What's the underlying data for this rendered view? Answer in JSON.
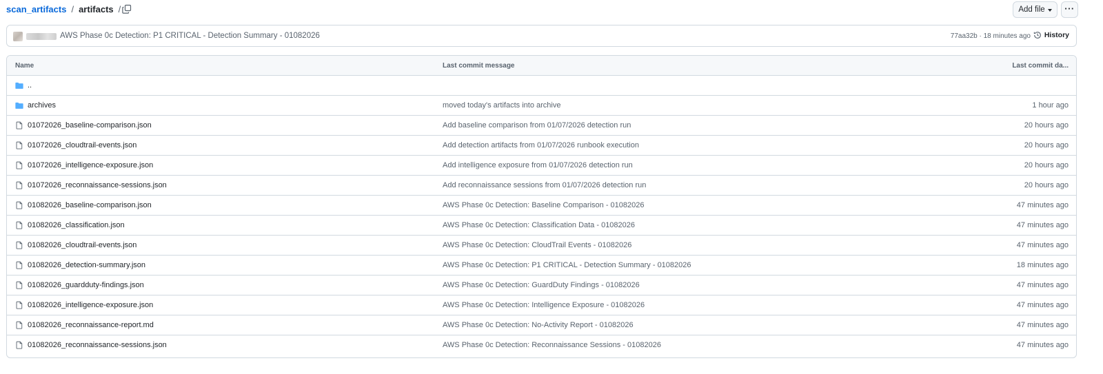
{
  "breadcrumb": {
    "root": "scan_artifacts",
    "separator": "/",
    "current": "artifacts",
    "trailing_separator": "/"
  },
  "toolbar": {
    "add_file_label": "Add file",
    "more_label": "···"
  },
  "commit": {
    "message": "AWS Phase 0c Detection: P1 CRITICAL - Detection Summary - 01082026",
    "meta": "77aa32b · 18 minutes ago",
    "history_label": "History"
  },
  "table": {
    "headers": {
      "name": "Name",
      "message": "Last commit message",
      "date": "Last commit da..."
    },
    "rows": [
      {
        "type": "folder",
        "name": "..",
        "message": "",
        "date": ""
      },
      {
        "type": "folder",
        "name": "archives",
        "message": "moved today's artifacts into archive",
        "date": "1 hour ago"
      },
      {
        "type": "file",
        "name": "01072026_baseline-comparison.json",
        "message": "Add baseline comparison from 01/07/2026 detection run",
        "date": "20 hours ago"
      },
      {
        "type": "file",
        "name": "01072026_cloudtrail-events.json",
        "message": "Add detection artifacts from 01/07/2026 runbook execution",
        "date": "20 hours ago"
      },
      {
        "type": "file",
        "name": "01072026_intelligence-exposure.json",
        "message": "Add intelligence exposure from 01/07/2026 detection run",
        "date": "20 hours ago"
      },
      {
        "type": "file",
        "name": "01072026_reconnaissance-sessions.json",
        "message": "Add reconnaissance sessions from 01/07/2026 detection run",
        "date": "20 hours ago"
      },
      {
        "type": "file",
        "name": "01082026_baseline-comparison.json",
        "message": "AWS Phase 0c Detection: Baseline Comparison - 01082026",
        "date": "47 minutes ago"
      },
      {
        "type": "file",
        "name": "01082026_classification.json",
        "message": "AWS Phase 0c Detection: Classification Data - 01082026",
        "date": "47 minutes ago"
      },
      {
        "type": "file",
        "name": "01082026_cloudtrail-events.json",
        "message": "AWS Phase 0c Detection: CloudTrail Events - 01082026",
        "date": "47 minutes ago"
      },
      {
        "type": "file",
        "name": "01082026_detection-summary.json",
        "message": "AWS Phase 0c Detection: P1 CRITICAL - Detection Summary - 01082026",
        "date": "18 minutes ago"
      },
      {
        "type": "file",
        "name": "01082026_guardduty-findings.json",
        "message": "AWS Phase 0c Detection: GuardDuty Findings - 01082026",
        "date": "47 minutes ago"
      },
      {
        "type": "file",
        "name": "01082026_intelligence-exposure.json",
        "message": "AWS Phase 0c Detection: Intelligence Exposure - 01082026",
        "date": "47 minutes ago"
      },
      {
        "type": "file",
        "name": "01082026_reconnaissance-report.md",
        "message": "AWS Phase 0c Detection: No-Activity Report - 01082026",
        "date": "47 minutes ago"
      },
      {
        "type": "file",
        "name": "01082026_reconnaissance-sessions.json",
        "message": "AWS Phase 0c Detection: Reconnaissance Sessions - 01082026",
        "date": "47 minutes ago"
      }
    ]
  },
  "icons": {
    "folder": "folder-icon",
    "file": "file-icon",
    "copy": "copy-icon",
    "history": "history-icon"
  },
  "colors": {
    "link": "#0969da",
    "folder": "#54aeff",
    "muted": "#59636e",
    "border": "#d1d9e0"
  }
}
